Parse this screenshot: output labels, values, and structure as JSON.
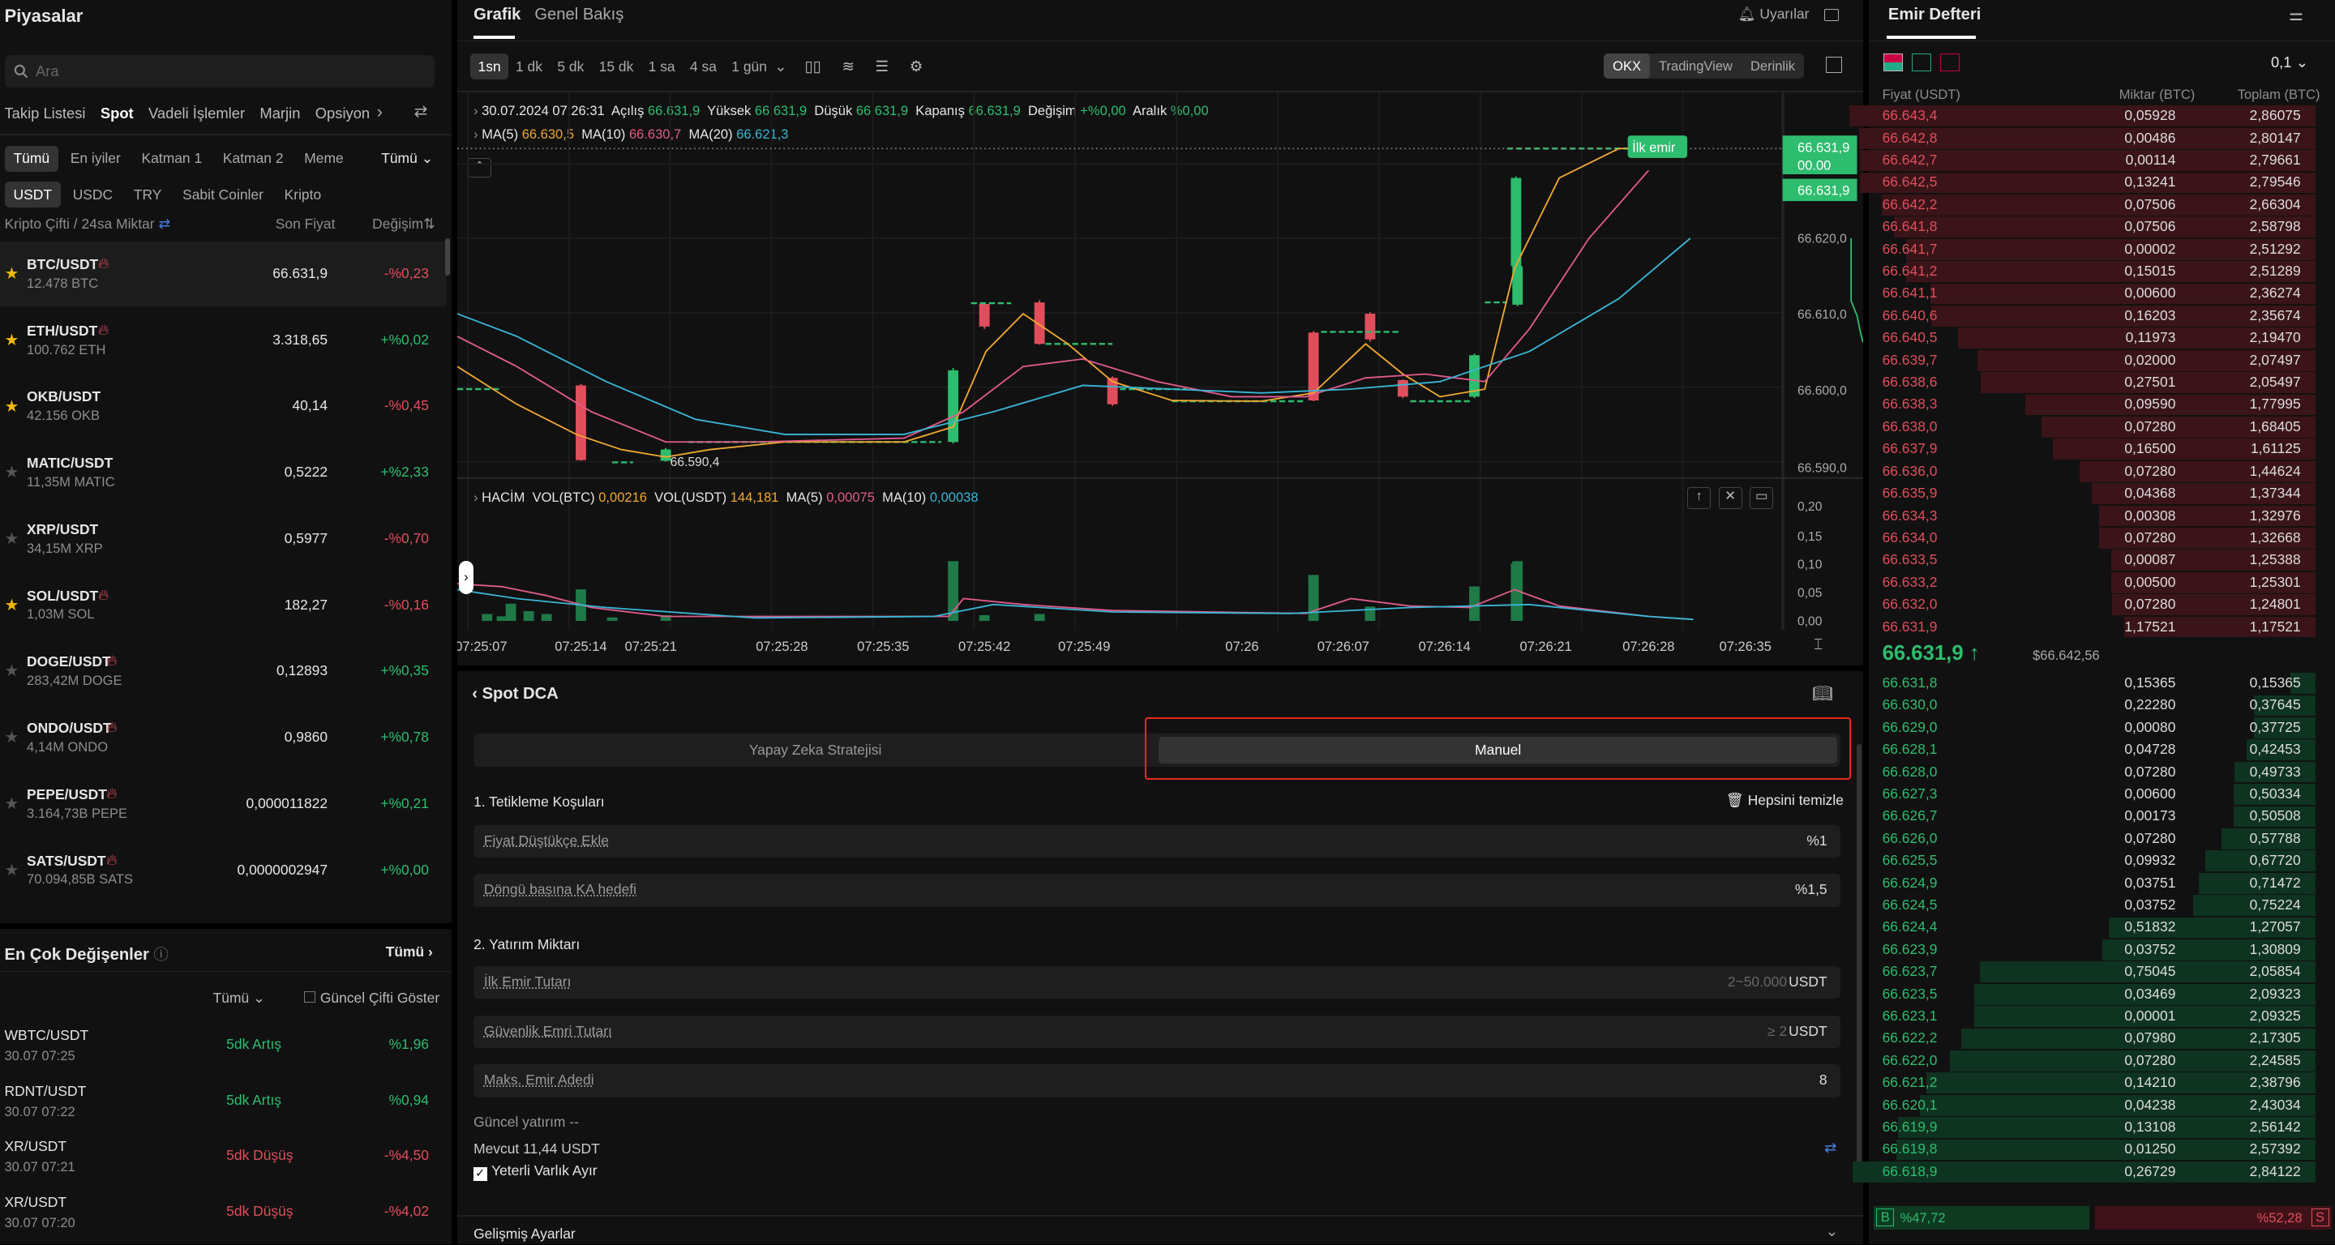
{
  "markets": {
    "title": "Piyasalar",
    "search_placeholder": "Ara",
    "tabs": [
      "Takip Listesi",
      "Spot",
      "Vadeli İşlemler",
      "Marjin",
      "Opsiyon"
    ],
    "filters": [
      "Tümü",
      "En iyiler",
      "Katman 1",
      "Katman 2",
      "Meme"
    ],
    "filter_all": "Tümü",
    "quotes": [
      "USDT",
      "USDC",
      "TRY",
      "Sabit Coinler",
      "Kripto"
    ],
    "col_pair": "Kripto Çifti / 24sa Miktar",
    "col_price": "Son Fiyat",
    "col_change": "Değişim",
    "rows": [
      {
        "pair": "BTC/USDT",
        "vol": "12.478 BTC",
        "price": "66.631,9",
        "change": "-%0,23",
        "star": true,
        "hot": true
      },
      {
        "pair": "ETH/USDT",
        "vol": "100.762 ETH",
        "price": "3.318,65",
        "change": "+%0,02",
        "star": true,
        "hot": true
      },
      {
        "pair": "OKB/USDT",
        "vol": "42.156 OKB",
        "price": "40,14",
        "change": "-%0,45",
        "star": true,
        "hot": false
      },
      {
        "pair": "MATIC/USDT",
        "vol": "11,35M MATIC",
        "price": "0,5222",
        "change": "+%2,33",
        "star": false,
        "hot": false
      },
      {
        "pair": "XRP/USDT",
        "vol": "34,15M XRP",
        "price": "0,5977",
        "change": "-%0,70",
        "star": false,
        "hot": false
      },
      {
        "pair": "SOL/USDT",
        "vol": "1,03M SOL",
        "price": "182,27",
        "change": "-%0,16",
        "star": true,
        "hot": true
      },
      {
        "pair": "DOGE/USDT",
        "vol": "283,42M DOGE",
        "price": "0,12893",
        "change": "+%0,35",
        "star": false,
        "hot": true
      },
      {
        "pair": "ONDO/USDT",
        "vol": "4,14M ONDO",
        "price": "0,9860",
        "change": "+%0,78",
        "star": false,
        "hot": true
      },
      {
        "pair": "PEPE/USDT",
        "vol": "3.164,73B PEPE",
        "price": "0,000011822",
        "change": "+%0,21",
        "star": false,
        "hot": true
      },
      {
        "pair": "SATS/USDT",
        "vol": "70.094,85B SATS",
        "price": "0,0000002947",
        "change": "+%0,00",
        "star": false,
        "hot": true
      }
    ]
  },
  "movers": {
    "title": "En Çok Değişenler",
    "all": "Tümü",
    "filter": "Tümü",
    "show_current": "Güncel Çifti Göster",
    "rows": [
      {
        "pair": "WBTC/USDT",
        "time": "30.07 07:25",
        "desc": "5dk Artış",
        "value": "%1,96",
        "up": true
      },
      {
        "pair": "RDNT/USDT",
        "time": "30.07 07:22",
        "desc": "5dk Artış",
        "value": "%0,94",
        "up": true
      },
      {
        "pair": "XR/USDT",
        "time": "30.07 07:21",
        "desc": "5dk Düşüş",
        "value": "-%4,50",
        "up": false
      },
      {
        "pair": "XR/USDT",
        "time": "30.07 07:20",
        "desc": "5dk Düşüş",
        "value": "-%4,02",
        "up": false
      }
    ]
  },
  "chart": {
    "tab_chart": "Grafik",
    "tab_overview": "Genel Bakış",
    "alerts": "Uyarılar",
    "intervals": [
      "1sn",
      "1 dk",
      "5 dk",
      "15 dk",
      "1 sa",
      "4 sa",
      "1 gün"
    ],
    "sources": [
      "OKX",
      "TradingView",
      "Derinlik"
    ],
    "ohlc": {
      "date": "30.07.2024 07:26:31",
      "open_l": "Açılış",
      "open": "66.631,9",
      "high_l": "Yüksek",
      "high": "66.631,9",
      "low_l": "Düşük",
      "low": "66.631,9",
      "close_l": "Kapanış",
      "close": "66.631,9",
      "chg_l": "Değişim",
      "chg": "+%0,00",
      "range_l": "Aralık",
      "range": "%0,00"
    },
    "ma": {
      "ma5_l": "MA(5)",
      "ma5": "66.630,5",
      "ma10_l": "MA(10)",
      "ma10": "66.630,7",
      "ma20_l": "MA(20)",
      "ma20": "66.621,3"
    },
    "first_order": "İlk emir",
    "price_tag": "66.631,9",
    "price_tag2": "00.00",
    "price_tag3": "66.631,9",
    "low_label": "66.590,4",
    "y_labels": [
      "66.620,0",
      "66.610,0",
      "66.600,0",
      "66.590,0"
    ],
    "vol_legend": {
      "title": "HACİM",
      "vb_l": "VOL(BTC)",
      "vb": "0,00216",
      "vu_l": "VOL(USDT)",
      "vu": "144,181",
      "m5_l": "MA(5)",
      "m5": "0,00075",
      "m10_l": "MA(10)",
      "m10": "0,00038"
    },
    "vol_y": [
      "0,20",
      "0,15",
      "0,10",
      "0,05",
      "0,00"
    ],
    "x_labels": [
      "07:25:07",
      "07:25:14",
      "07:25:21",
      "07:25:28",
      "07:25:35",
      "07:25:42",
      "07:25:49",
      "07:26",
      "07:26:07",
      "07:26:14",
      "07:26:21",
      "07:26:28",
      "07:26:35"
    ]
  },
  "dca": {
    "title": "Spot DCA",
    "tab_ai": "Yapay Zeka Stratejisi",
    "tab_manual": "Manuel",
    "s1": "1. Tetikleme Koşuları",
    "clear": "Hepsini temizle",
    "f1_label": "Fiyat Düştükçe Ekle",
    "f1_value": "%1",
    "f2_label": "Döngü başına KA hedefi",
    "f2_value": "%1,5",
    "s2": "2. Yatırım Miktarı",
    "f3_label": "İlk Emir Tutarı",
    "f3_hint": "2~50.000",
    "f3_unit": "USDT",
    "f4_label": "Güvenlik Emri Tutarı",
    "f4_hint": "≥ 2",
    "f4_unit": "USDT",
    "f5_label": "Maks. Emir Adedi",
    "f5_value": "8",
    "current_inv": "Güncel yatırım --",
    "available": "Mevcut 11,44 USDT",
    "reserve": "Yeterli Varlık Ayır",
    "advanced": "Gelişmiş Ayarlar"
  },
  "orderbook": {
    "title": "Emir Defteri",
    "step": "0,1",
    "col_price": "Fiyat (USDT)",
    "col_qty": "Miktar (BTC)",
    "col_total": "Toplam (BTC)",
    "asks": [
      [
        "66.643,4",
        "0,05928",
        "2,86075"
      ],
      [
        "66.642,8",
        "0,00486",
        "2,80147"
      ],
      [
        "66.642,7",
        "0,00114",
        "2,79661"
      ],
      [
        "66.642,5",
        "0,13241",
        "2,79546"
      ],
      [
        "66.642,2",
        "0,07506",
        "2,66304"
      ],
      [
        "66.641,8",
        "0,07506",
        "2,58798"
      ],
      [
        "66.641,7",
        "0,00002",
        "2,51292"
      ],
      [
        "66.641,2",
        "0,15015",
        "2,51289"
      ],
      [
        "66.641,1",
        "0,00600",
        "2,36274"
      ],
      [
        "66.640,6",
        "0,16203",
        "2,35674"
      ],
      [
        "66.640,5",
        "0,11973",
        "2,19470"
      ],
      [
        "66.639,7",
        "0,02000",
        "2,07497"
      ],
      [
        "66.638,6",
        "0,27501",
        "2,05497"
      ],
      [
        "66.638,3",
        "0,09590",
        "1,77995"
      ],
      [
        "66.638,0",
        "0,07280",
        "1,68405"
      ],
      [
        "66.637,9",
        "0,16500",
        "1,61125"
      ],
      [
        "66.636,0",
        "0,07280",
        "1,44624"
      ],
      [
        "66.635,9",
        "0,04368",
        "1,37344"
      ],
      [
        "66.634,3",
        "0,00308",
        "1,32976"
      ],
      [
        "66.634,0",
        "0,07280",
        "1,32668"
      ],
      [
        "66.633,5",
        "0,00087",
        "1,25388"
      ],
      [
        "66.633,2",
        "0,00500",
        "1,25301"
      ],
      [
        "66.632,0",
        "0,07280",
        "1,24801"
      ],
      [
        "66.631,9",
        "1,17521",
        "1,17521"
      ]
    ],
    "last_price": "66.631,9",
    "last_arrow": "↑",
    "index_price": "$66.642,56",
    "bids": [
      [
        "66.631,8",
        "0,15365",
        "0,15365"
      ],
      [
        "66.630,0",
        "0,22280",
        "0,37645"
      ],
      [
        "66.629,0",
        "0,00080",
        "0,37725"
      ],
      [
        "66.628,1",
        "0,04728",
        "0,42453"
      ],
      [
        "66.628,0",
        "0,07280",
        "0,49733"
      ],
      [
        "66.627,3",
        "0,00600",
        "0,50334"
      ],
      [
        "66.626,7",
        "0,00173",
        "0,50508"
      ],
      [
        "66.626,0",
        "0,07280",
        "0,57788"
      ],
      [
        "66.625,5",
        "0,09932",
        "0,67720"
      ],
      [
        "66.624,9",
        "0,03751",
        "0,71472"
      ],
      [
        "66.624,5",
        "0,03752",
        "0,75224"
      ],
      [
        "66.624,4",
        "0,51832",
        "1,27057"
      ],
      [
        "66.623,9",
        "0,03752",
        "1,30809"
      ],
      [
        "66.623,7",
        "0,75045",
        "2,05854"
      ],
      [
        "66.623,5",
        "0,03469",
        "2,09323"
      ],
      [
        "66.623,1",
        "0,00001",
        "2,09325"
      ],
      [
        "66.622,2",
        "0,07980",
        "2,17305"
      ],
      [
        "66.622,0",
        "0,07280",
        "2,24585"
      ],
      [
        "66.621,2",
        "0,14210",
        "2,38796"
      ],
      [
        "66.620,1",
        "0,04238",
        "2,43034"
      ],
      [
        "66.619,9",
        "0,13108",
        "2,56142"
      ],
      [
        "66.619,8",
        "0,01250",
        "2,57392"
      ],
      [
        "66.618,9",
        "0,26729",
        "2,84122"
      ]
    ],
    "buy_tag": "B",
    "buy_pct": "%47,72",
    "sell_pct": "%52,28",
    "sell_tag": "S",
    "buy_ratio": 0.4772
  },
  "colors": {
    "up": "#2ebd6e",
    "down": "#e04e5c",
    "ma5": "#f0a830",
    "ma10": "#e05b8c",
    "ma20": "#39b6d6",
    "accent_border": "#e8291c"
  }
}
